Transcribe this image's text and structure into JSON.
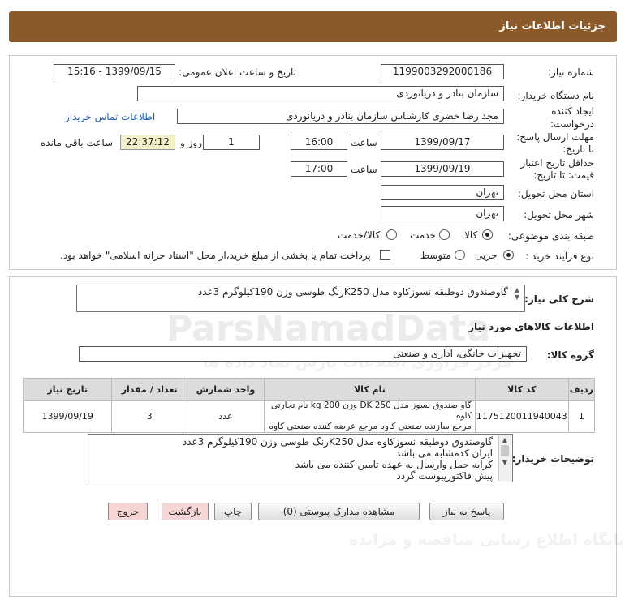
{
  "page_title": "جزئیات اطلاعات نیاز",
  "fields": {
    "need_number_label": "شماره نیاز:",
    "need_number": "1199003292000186",
    "announce_label": "تاریخ و ساعت اعلان عمومی:",
    "announce_value": "1399/09/15 - 15:16",
    "buyer_org_label": "نام دستگاه خریدار:",
    "buyer_org": "سازمان بنادر و دریانوردی",
    "creator_label_1": "ایجاد کننده",
    "creator_label_2": "درخواست:",
    "creator": "مجد رضا خضری کارشناس سازمان بنادر و دریانوردی",
    "contact_link": "اطلاعات تماس خریدار",
    "deadline_label_1": "مهلت ارسال پاسخ:",
    "deadline_label_2": "تا تاریخ:",
    "deadline_date": "1399/09/17",
    "time_label": "ساعت",
    "deadline_time": "16:00",
    "days_value": "1",
    "days_label": "روز و",
    "remaining_time": "22:37:12",
    "remaining_label": "ساعت باقی مانده",
    "validity_label_1": "حداقل تاریخ اعتبار",
    "validity_label_2": "قیمت: تا تاریخ:",
    "validity_date": "1399/09/19",
    "validity_time": "17:00",
    "province_label": "استان محل تحویل:",
    "province": "تهران",
    "city_label": "شهر محل تحویل:",
    "city": "تهران",
    "category_label": "طبقه بندی موضوعی:",
    "category_options": [
      "کالا",
      "خدمت",
      "کالا/خدمت"
    ],
    "category_selected": "کالا",
    "process_label": "نوع فرآیند خرید :",
    "process_options": [
      "جزیی",
      "متوسط"
    ],
    "process_selected": "جزیی",
    "payment_note": "پرداخت تمام یا بخشی از مبلغ خرید،از محل \"اسناد خزانه اسلامی\" خواهد بود."
  },
  "summary": {
    "label": "شرح کلی نیاز:",
    "text": "گاوصندوق دوطبقه نسوزکاوه مدل K250رنگ طوسی وزن 190کیلوگرم 3عدد"
  },
  "goods": {
    "section_title": "اطلاعات کالاهای مورد نیاز",
    "group_label": "گروه کالا:",
    "group_value": "تجهیزات خانگی، اداری و صنعتی",
    "columns": [
      "ردیف",
      "کد کالا",
      "نام کالا",
      "واحد شمارش",
      "تعداد / مقدار",
      "تاریخ نیاز"
    ],
    "rows": [
      {
        "row": "1",
        "code": "1175120011940043",
        "name_line1": "گاو صندوق نسوز مدل DK 250 وزن 200 kg نام تجارتی کاوه",
        "name_line2": "مرجع سازنده صنعتی کاوه مرجع عرضه کننده صنعتی کاوه",
        "unit": "عدد",
        "qty": "3",
        "date": "1399/09/19"
      }
    ]
  },
  "buyer_notes": {
    "label": "توضیحات خریدار:",
    "lines": [
      "گاوصندوق دوطبقه نسوزکاوه مدل K250رنگ طوسی وزن 190کیلوگرم 3عدد",
      "ایران کدمشابه می باشد",
      "کرایه حمل وارسال به عهده تامین کننده می باشد",
      "پیش فاکتورپیوست گردد"
    ]
  },
  "buttons": {
    "reply": "پاسخ به نیاز",
    "view_docs": "مشاهده مدارک پیوستی (0)",
    "print": "چاپ",
    "back": "بازگشت",
    "exit": "خروج"
  },
  "watermark": {
    "brand": "ParsNamadData",
    "line1": "مرکز فراوری اطلاعات پارس نماد داده ها",
    "line2": "پایگاه اطلاع رسانی مناقصه و مزایده"
  },
  "colors": {
    "title_bar": "#8b5a2b",
    "link": "#1a5fb4",
    "pink_button": "#f6d5d5",
    "remaining_bg": "#f2efc9"
  }
}
